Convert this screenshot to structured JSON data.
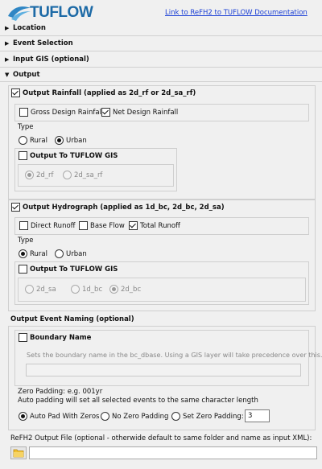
{
  "header": {
    "logo_text": "TUFLOW",
    "doc_link": "Link to ReFH2 to TUFLOW Documentation"
  },
  "sections": {
    "location": "Location",
    "event_selection": "Event Selection",
    "input_gis": "Input GIS (optional)",
    "output": "Output"
  },
  "rainfall": {
    "title": "Output Rainfall (applied as 2d_rf or 2d_sa_rf)",
    "gross": "Gross Design Rainfall",
    "net": "Net Design Rainfall",
    "type_label": "Type",
    "rural": "Rural",
    "urban": "Urban",
    "to_gis": "Output To TUFLOW GIS",
    "opt_2d_rf": "2d_rf",
    "opt_2d_sa_rf": "2d_sa_rf"
  },
  "hydrograph": {
    "title": "Output Hydrograph (applied as 1d_bc, 2d_bc, 2d_sa)",
    "direct": "Direct Runoff",
    "base": "Base Flow",
    "total": "Total Runoff",
    "type_label": "Type",
    "rural": "Rural",
    "urban": "Urban",
    "to_gis": "Output To TUFLOW GIS",
    "opt_2d_sa": "2d_sa",
    "opt_1d_bc": "1d_bc",
    "opt_2d_bc": "2d_bc"
  },
  "naming": {
    "title": "Output Event Naming (optional)",
    "boundary_name": "Boundary Name",
    "boundary_hint": "Sets the boundary name in the bc_dbase. Using a GIS layer will take precedence over this.",
    "zero_padding_example": "Zero Padding: e.g. 001yr",
    "auto_padding_note": "Auto padding will set all selected events to the same character length",
    "auto_pad": "Auto Pad With Zeros",
    "no_pad": "No Zero Padding",
    "set_pad": "Set Zero Padding:",
    "pad_value": "3"
  },
  "output_file": {
    "label": "ReFH2 Output File (optional - otherwide default to same folder and name as input XML):",
    "value": ""
  },
  "colors": {
    "logo": "#1d6aa6",
    "link": "#1a3fd6"
  },
  "icons": {
    "collapsed": "triangle-right-icon",
    "expanded": "triangle-down-icon",
    "folder": "folder-icon"
  }
}
